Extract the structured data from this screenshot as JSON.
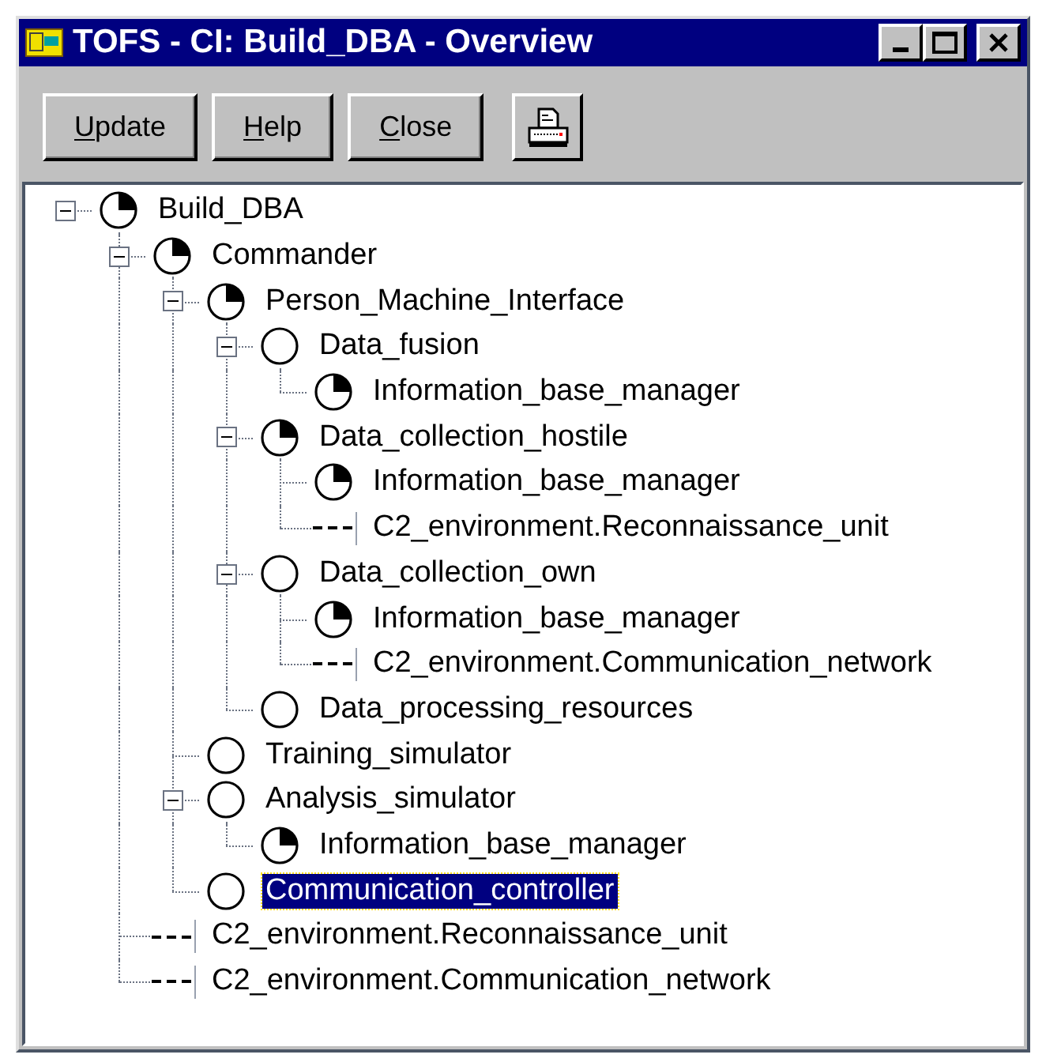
{
  "window": {
    "title": "TOFS - CI: Build_DBA - Overview"
  },
  "toolbar": {
    "buttons": [
      {
        "label": "Update"
      },
      {
        "label": "Help"
      },
      {
        "label": "Close"
      }
    ]
  },
  "tree": [
    {
      "label": "Build_DBA",
      "kind": "component",
      "in_progress": true,
      "expanded": true,
      "selected": false,
      "children": [
        {
          "label": "Commander",
          "kind": "component",
          "in_progress": true,
          "expanded": true,
          "selected": false,
          "children": [
            {
              "label": "Person_Machine_Interface",
              "kind": "component",
              "in_progress": true,
              "expanded": true,
              "selected": false,
              "children": [
                {
                  "label": "Data_fusion",
                  "kind": "component",
                  "in_progress": false,
                  "expanded": true,
                  "selected": false,
                  "children": [
                    {
                      "label": "Information_base_manager",
                      "kind": "component",
                      "in_progress": true,
                      "selected": false
                    }
                  ]
                },
                {
                  "label": "Data_collection_hostile",
                  "kind": "component",
                  "in_progress": true,
                  "expanded": true,
                  "selected": false,
                  "children": [
                    {
                      "label": "Information_base_manager",
                      "kind": "component",
                      "in_progress": true,
                      "selected": false
                    },
                    {
                      "label": "C2_environment.Reconnaissance_unit",
                      "kind": "interface",
                      "selected": false
                    }
                  ]
                },
                {
                  "label": "Data_collection_own",
                  "kind": "component",
                  "in_progress": false,
                  "expanded": true,
                  "selected": false,
                  "children": [
                    {
                      "label": "Information_base_manager",
                      "kind": "component",
                      "in_progress": true,
                      "selected": false
                    },
                    {
                      "label": "C2_environment.Communication_network",
                      "kind": "interface",
                      "selected": false
                    }
                  ]
                },
                {
                  "label": "Data_processing_resources",
                  "kind": "component",
                  "in_progress": false,
                  "selected": false
                }
              ]
            },
            {
              "label": "Training_simulator",
              "kind": "component",
              "in_progress": false,
              "selected": false
            },
            {
              "label": "Analysis_simulator",
              "kind": "component",
              "in_progress": false,
              "expanded": true,
              "selected": false,
              "children": [
                {
                  "label": "Information_base_manager",
                  "kind": "component",
                  "in_progress": true,
                  "selected": false
                }
              ]
            },
            {
              "label": "Communication_controller",
              "kind": "component",
              "in_progress": false,
              "selected": true
            }
          ]
        },
        {
          "label": "C2_environment.Reconnaissance_unit",
          "kind": "interface",
          "selected": false
        },
        {
          "label": "C2_environment.Communication_network",
          "kind": "interface",
          "selected": false
        }
      ]
    }
  ]
}
